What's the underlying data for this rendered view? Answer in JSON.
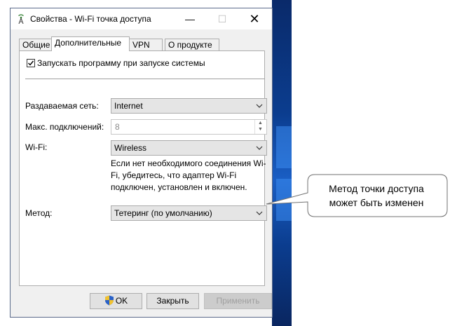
{
  "window": {
    "title": "Свойства - Wi-Fi точка доступа",
    "minimize_glyph": "—",
    "maximize_glyph": "☐",
    "close_glyph": "✕"
  },
  "tabs": [
    {
      "label": "Общие",
      "active": false
    },
    {
      "label": "Дополнительные",
      "active": true
    },
    {
      "label": "VPN",
      "active": false
    },
    {
      "label": "О продукте",
      "active": false
    }
  ],
  "settings": {
    "autostart_label": "Запускать программу при запуске системы",
    "autostart_checked": true,
    "shared_network_label": "Раздаваемая сеть:",
    "shared_network_value": "Internet",
    "max_connections_label": "Макс. подключений:",
    "max_connections_value": "8",
    "wifi_label": "Wi-Fi:",
    "wifi_value": "Wireless",
    "wifi_hint": "Если нет необходимого соединения Wi-Fi, убедитесь, что адаптер Wi-Fi подключен, установлен и включен.",
    "method_label": "Метод:",
    "method_value": "Тетеринг (по умолчанию)"
  },
  "buttons": {
    "ok": "OK",
    "close": "Закрыть",
    "apply": "Применить"
  },
  "callout": {
    "line1": "Метод точки доступа",
    "line2": "может быть изменен"
  },
  "icons": {
    "app": "wifi-tower-icon",
    "ok": "uac-shield-icon",
    "dropdown": "chevron-down-icon"
  }
}
